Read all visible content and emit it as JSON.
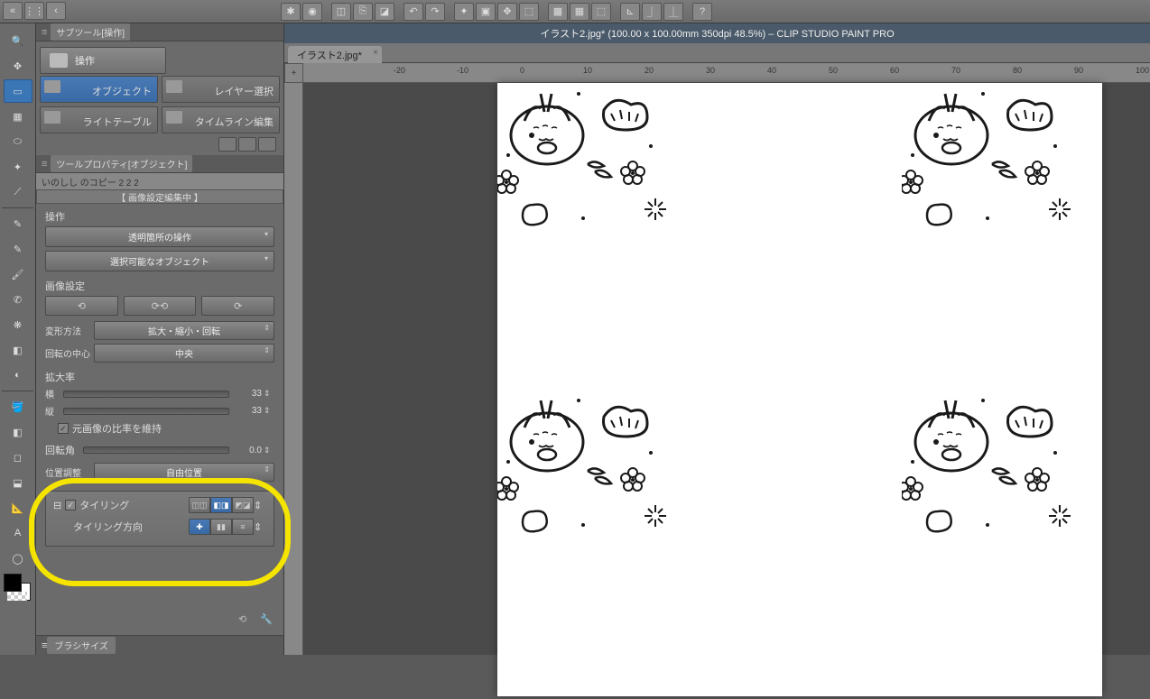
{
  "app_title": "CLIP STUDIO PAINT PRO",
  "document": {
    "title": "イラスト2.jpg* (100.00 x 100.00mm 350dpi 48.5%)  –  CLIP STUDIO PAINT PRO",
    "tab_name": "イラスト2.jpg*"
  },
  "ruler_ticks": [
    "-20",
    "-10",
    "0",
    "10",
    "20",
    "30",
    "40",
    "50",
    "60",
    "70",
    "80",
    "90",
    "100"
  ],
  "subtool_panel": {
    "title": "サブツール[操作]",
    "main_button": "操作",
    "buttons": [
      {
        "label": "オブジェクト",
        "active": true
      },
      {
        "label": "レイヤー選択",
        "active": false
      },
      {
        "label": "ライトテーブル",
        "active": false
      },
      {
        "label": "タイムライン編集",
        "active": false
      }
    ]
  },
  "tool_property": {
    "title": "ツールプロパティ[オブジェクト]",
    "target_name": "いのしし のコピー 2 2 2",
    "editing_label": "【 画像設定編集中 】",
    "operation": {
      "label": "操作",
      "transparent_op": "透明箇所の操作",
      "selectable": "選択可能なオブジェクト"
    },
    "image_settings_label": "画像設定",
    "transform": {
      "method_label": "変形方法",
      "method_value": "拡大・縮小・回転",
      "center_label": "回転の中心",
      "center_value": "中央"
    },
    "scale": {
      "label": "拡大率",
      "width_label": "横",
      "width_value": "33",
      "height_label": "縦",
      "height_value": "33",
      "keep_ratio_label": "元画像の比率を維持",
      "keep_ratio_checked": true
    },
    "rotation": {
      "label": "回転角",
      "value": "0.0"
    },
    "position": {
      "label": "位置調整",
      "value": "自由位置"
    },
    "tiling": {
      "label": "タイリング",
      "checked": true,
      "direction_label": "タイリング方向",
      "pattern_mode_selected": 1,
      "direction_mode_selected": 0
    }
  },
  "brush_panel_title": "ブラシサイズ",
  "toolbar_icons": [
    "asterisk",
    "swirl",
    "new",
    "open",
    "folder",
    "spacer",
    "undo",
    "redo",
    "spacer",
    "clear",
    "fill",
    "crop",
    "move",
    "spacer",
    "grid",
    "ruler",
    "perspective",
    "select",
    "spacer",
    "navi",
    "sub",
    "info",
    "spacer",
    "help"
  ]
}
